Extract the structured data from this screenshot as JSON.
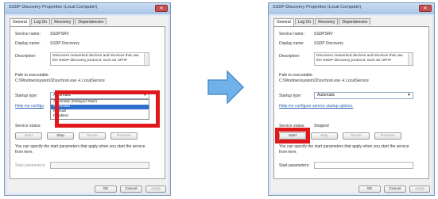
{
  "title": "SSDP Discovery Properties (Local Computer)",
  "tabs": [
    "General",
    "Log On",
    "Recovery",
    "Dependencies"
  ],
  "service_name_label": "Service name:",
  "service_name_value": "SSDPSRV",
  "display_name_label": "Display name:",
  "display_name_value": "SSDP Discovery",
  "description_label": "Description:",
  "description_line1": "Discovers networked devices and services that use",
  "description_line2": "the SSDP discovery protocol, such as UPnP",
  "path_label": "Path to executable:",
  "path_value": "C:\\Windows\\system32\\svchost.exe -k LocalService",
  "startup_type_label": "Startup type:",
  "startup_type_value": "Automatic",
  "startup_options": [
    "Automatic (Delayed Start)",
    "Automatic",
    "Manual",
    "Disabled"
  ],
  "help_link": "Help me configure service startup options.",
  "help_link_truncated": "Help me configu",
  "service_status_label": "Service status:",
  "service_status_value": "Stopped",
  "buttons": {
    "start": "Start",
    "stop": "Stop",
    "pause": "Pause",
    "resume": "Resume"
  },
  "start_params_note_line1": "You can specify the start parameters that apply when you start the service",
  "start_params_note_line2": "from here.",
  "start_params_label": "Start parameters:",
  "footer": {
    "ok": "OK",
    "cancel": "Cancel",
    "apply": "Apply"
  },
  "close_glyph": "✕",
  "arrow_glyph": "▼",
  "colors": {
    "highlight_red": "#e0181b",
    "arrow_blue": "#6fb1e8",
    "selection_blue": "#2f6fd0"
  }
}
